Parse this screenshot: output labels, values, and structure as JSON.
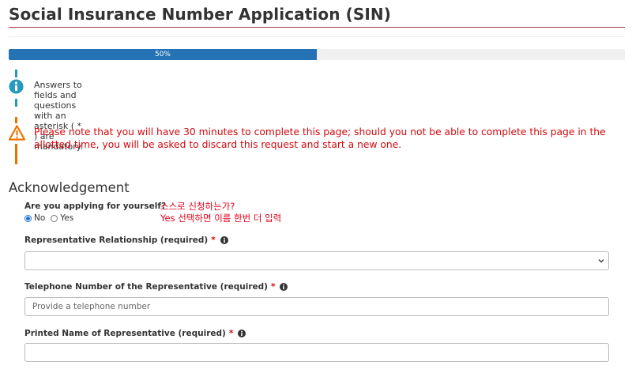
{
  "page": {
    "title": "Social Insurance Number Application (SIN)"
  },
  "progress": {
    "label": "50%",
    "value": 0.5,
    "fill_color": "#2572b4"
  },
  "alerts": {
    "info": {
      "icon": "info-icon",
      "text": "Answers to fields and questions with an asterisk ( * ) are mandatory."
    },
    "warning": {
      "icon": "warning-icon",
      "text": "Please note that you will have 30 minutes to complete this page; should you not be able to complete this page in the allotted time, you will be asked to discard this request and start a new one."
    }
  },
  "acknowledgement": {
    "section_title": "Acknowledgement",
    "question": "Are you applying for yourself?",
    "options": [
      {
        "label": "No",
        "checked": true
      },
      {
        "label": "Yes",
        "checked": false
      }
    ],
    "note_line1": "스스로 신청하는가?",
    "note_line2": "Yes 선택하면 이름 한번 더 입력"
  },
  "fields": {
    "relationship": {
      "label": "Representative Relationship (required)",
      "required_marker": "*",
      "value": ""
    },
    "telephone": {
      "label": "Telephone Number of the Representative (required)",
      "required_marker": "*",
      "placeholder": "Provide a telephone number"
    },
    "printed_name": {
      "label": "Printed Name of Representative (required)",
      "required_marker": "*",
      "value": ""
    }
  },
  "colors": {
    "title_rule": "#af3c43",
    "info_accent": "#269abc",
    "warning_accent": "#ee7100",
    "warning_text": "#d3080c",
    "note_text": "#e3001b"
  }
}
